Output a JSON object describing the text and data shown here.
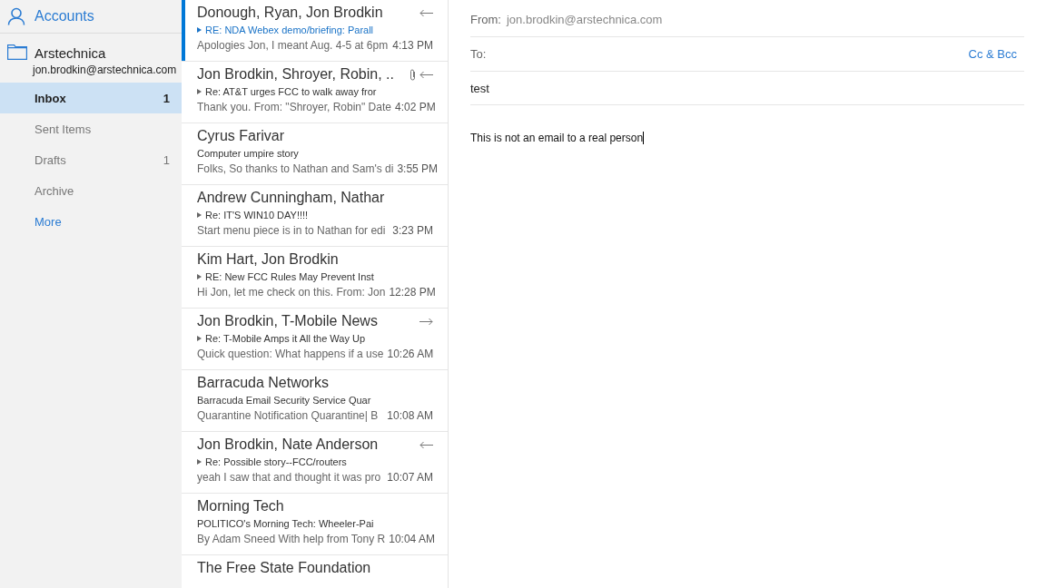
{
  "sidebar": {
    "header": "Accounts",
    "account": {
      "name": "Arstechnica",
      "email": "jon.brodkin@arstechnica.com"
    },
    "folders": [
      {
        "name": "Inbox",
        "count": "1",
        "selected": true
      },
      {
        "name": "Sent Items",
        "selected": false
      },
      {
        "name": "Drafts",
        "count": "1",
        "selected": false
      },
      {
        "name": "Archive",
        "selected": false
      }
    ],
    "more": "More"
  },
  "messages": [
    {
      "sender": "Donough, Ryan, Jon Brodkin",
      "subject": "RE: NDA Webex demo/briefing: Parall",
      "preview": "Apologies Jon, I meant Aug. 4-5 at 6pm",
      "time": "4:13 PM",
      "selected": true,
      "unread": true,
      "thread": true,
      "attachment": false,
      "replied": true,
      "forwarded": false
    },
    {
      "sender": "Jon Brodkin, Shroyer, Robin, ..",
      "subject": "Re: AT&T urges FCC to walk away fror",
      "preview": "Thank you. From: \"Shroyer, Robin\" Date",
      "time": "4:02 PM",
      "selected": false,
      "unread": false,
      "thread": true,
      "attachment": true,
      "replied": true,
      "forwarded": false
    },
    {
      "sender": "Cyrus Farivar",
      "subject": "Computer umpire story",
      "preview": "Folks, So thanks to Nathan and Sam's di",
      "time": "3:55 PM",
      "selected": false,
      "unread": false,
      "thread": false,
      "attachment": false,
      "replied": false,
      "forwarded": false
    },
    {
      "sender": "Andrew Cunningham, Nathar",
      "subject": "Re: IT'S WIN10 DAY!!!!",
      "preview": "Start menu piece is in to Nathan for edi",
      "time": "3:23 PM",
      "selected": false,
      "unread": false,
      "thread": true,
      "attachment": false,
      "replied": false,
      "forwarded": false
    },
    {
      "sender": "Kim Hart, Jon Brodkin",
      "subject": "RE: New FCC Rules May Prevent Inst",
      "preview": "Hi Jon, let me check on this. From: Jon",
      "time": "12:28 PM",
      "selected": false,
      "unread": false,
      "thread": true,
      "attachment": false,
      "replied": false,
      "forwarded": false
    },
    {
      "sender": "Jon Brodkin, T-Mobile News",
      "subject": "Re: T-Mobile Amps it All the Way Up",
      "preview": "Quick question: What happens if a use",
      "time": "10:26 AM",
      "selected": false,
      "unread": false,
      "thread": true,
      "attachment": false,
      "replied": false,
      "forwarded": true
    },
    {
      "sender": "Barracuda Networks",
      "subject": "Barracuda Email Security Service Quar",
      "preview": "Quarantine Notification Quarantine| B",
      "time": "10:08 AM",
      "selected": false,
      "unread": false,
      "thread": false,
      "attachment": false,
      "replied": false,
      "forwarded": false
    },
    {
      "sender": "Jon Brodkin, Nate Anderson",
      "subject": "Re: Possible story--FCC/routers",
      "preview": "yeah I saw that and thought it was pro",
      "time": "10:07 AM",
      "selected": false,
      "unread": false,
      "thread": true,
      "attachment": false,
      "replied": true,
      "forwarded": false
    },
    {
      "sender": "Morning Tech",
      "subject": "POLITICO's Morning Tech: Wheeler-Pai",
      "preview": "By Adam Sneed With help from Tony R",
      "time": "10:04 AM",
      "selected": false,
      "unread": false,
      "thread": false,
      "attachment": false,
      "replied": false,
      "forwarded": false
    },
    {
      "sender": "The Free State Foundation",
      "selected": false,
      "attachment": false,
      "replied": false,
      "forwarded": false
    }
  ],
  "compose": {
    "from_label": "From:",
    "from": "jon.brodkin@arstechnica.com",
    "to_label": "To:",
    "cc_bcc": "Cc & Bcc",
    "subject": "test",
    "body": "This is not an email to a real person"
  }
}
